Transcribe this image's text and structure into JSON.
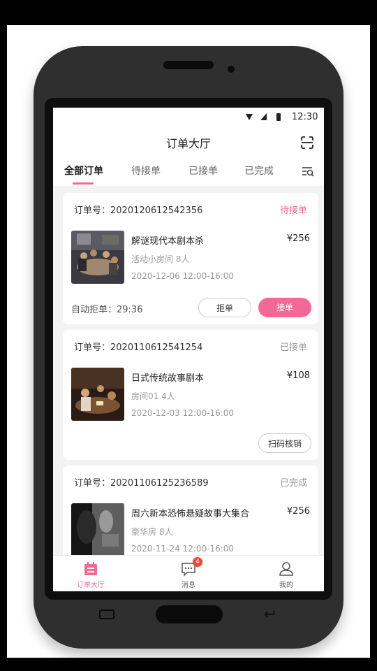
{
  "status_bar": {
    "time": "12:30"
  },
  "header": {
    "title": "订单大厅",
    "scan_icon": "scan-icon"
  },
  "tabs": [
    {
      "label": "全部订单",
      "active": true
    },
    {
      "label": "待接单"
    },
    {
      "label": "已接单"
    },
    {
      "label": "已完成"
    }
  ],
  "filter_icon": "filter-search-icon",
  "orders": [
    {
      "order_no": "订单号：2020120612542356",
      "status": "待接单",
      "name": "解谜现代本剧本杀",
      "price": "¥256",
      "room": "活动小房间   8人",
      "time": "2020-12-06 12:00-16:00",
      "auto_reject": "自动拒单：29:36",
      "reject_label": "拒单",
      "accept_label": "接单"
    },
    {
      "order_no": "订单号：2020110612541254",
      "status": "已接单",
      "name": "日式传统故事剧本",
      "price": "¥108",
      "room": "房间01   4人",
      "time": "2020-12-03 12:00-16:00",
      "scan_label": "扫码核销"
    },
    {
      "order_no": "订单号：20201106125236589",
      "status": "已完成",
      "name": "周六新本恐怖悬疑故事大集合",
      "price": "¥256",
      "room": "豪华房   8人",
      "time": "2020-11-24 12:00-16:00"
    }
  ],
  "bottom_nav": [
    {
      "label": "订单大厅",
      "icon": "order-hall-icon",
      "active": true
    },
    {
      "label": "消息",
      "icon": "message-icon",
      "badge": "4"
    },
    {
      "label": "我的",
      "icon": "profile-icon"
    }
  ],
  "colors": {
    "accent": "#f06a95",
    "badge": "#f0453a"
  }
}
